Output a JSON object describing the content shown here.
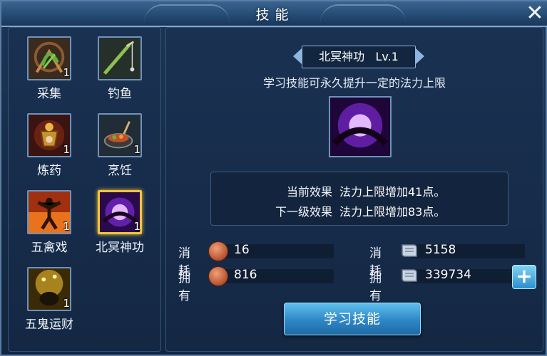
{
  "window": {
    "title": "技能",
    "close_icon": "close-icon"
  },
  "skills": [
    {
      "name": "采集",
      "level": "1",
      "icon": "gathering-icon"
    },
    {
      "name": "钓鱼",
      "level": "",
      "icon": "fishing-rod-icon"
    },
    {
      "name": "炼药",
      "level": "1",
      "icon": "alchemy-cauldron-icon"
    },
    {
      "name": "烹饪",
      "level": "1",
      "icon": "cooking-wok-icon"
    },
    {
      "name": "五禽戏",
      "level": "1",
      "icon": "martial-pose-icon"
    },
    {
      "name": "北冥神功",
      "level": "1",
      "icon": "purple-orb-icon",
      "selected": true
    },
    {
      "name": "五鬼运财",
      "level": "1",
      "icon": "treasure-pot-icon"
    }
  ],
  "detail": {
    "title": "北冥神功",
    "level": "Lv.1",
    "description": "学习技能可永久提升一定的法力上限",
    "current_effect_label": "当前效果",
    "current_effect_value": "法力上限增加41点。",
    "next_effect_label": "下一级效果",
    "next_effect_value": "法力上限增加83点。"
  },
  "costs": {
    "consume_label": "消耗",
    "own_label": "拥有",
    "coin_consume": "16",
    "coin_own": "816",
    "scroll_consume": "5158",
    "scroll_own": "339734"
  },
  "buttons": {
    "learn": "学习技能",
    "plus": "+"
  },
  "colors": {
    "selected_border": "#f3c53a",
    "button_blue": "#2e86c4"
  }
}
